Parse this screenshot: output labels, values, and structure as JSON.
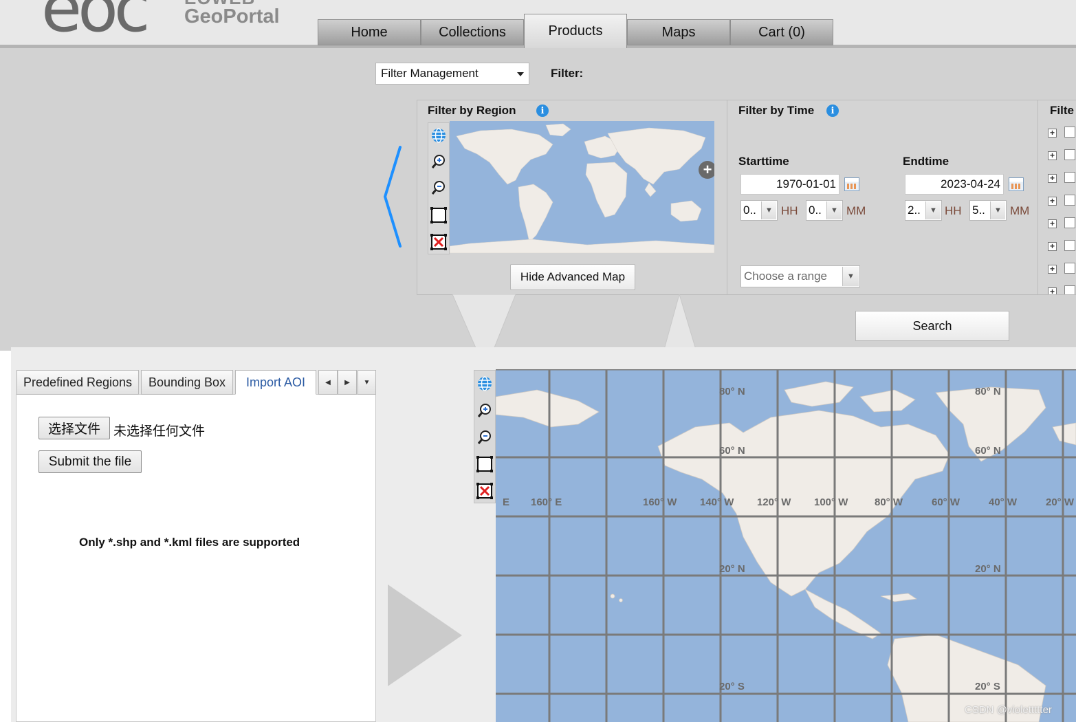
{
  "logo": {
    "mark": "eoc",
    "line1": "EOWEB",
    "line2": "GeoPortal"
  },
  "nav": {
    "tabs": [
      {
        "label": "Home"
      },
      {
        "label": "Collections"
      },
      {
        "label": "Products",
        "active": true
      },
      {
        "label": "Maps"
      },
      {
        "label": "Cart (0)"
      }
    ]
  },
  "filter_bar": {
    "management_select": "Filter Management",
    "filter_label": "Filter:"
  },
  "region_panel": {
    "title": "Filter by Region",
    "hide_map_button": "Hide Advanced Map",
    "tools": [
      "globe-icon",
      "zoom-in-icon",
      "zoom-out-icon",
      "draw-box-icon",
      "clear-box-icon"
    ]
  },
  "time_panel": {
    "title": "Filter by Time",
    "start": {
      "label": "Starttime",
      "date": "1970-01-01",
      "hour": "0..",
      "minute": "0..",
      "hour_unit": "HH",
      "minute_unit": "MM"
    },
    "end": {
      "label": "Endtime",
      "date": "2023-04-24",
      "hour": "2..",
      "minute": "5..",
      "hour_unit": "HH",
      "minute_unit": "MM"
    },
    "range_placeholder": "Choose a range"
  },
  "other_panel": {
    "title": "Filte"
  },
  "search_button": "Search",
  "aoi_panel": {
    "tabs": [
      {
        "label": "Predefined Regions"
      },
      {
        "label": "Bounding Box"
      },
      {
        "label": "Import AOI",
        "active": true
      }
    ],
    "choose_file_button": "选择文件",
    "no_file_text": "未选择任何文件",
    "submit_button": "Submit the file",
    "supported_note": "Only *.shp and *.kml files are supported"
  },
  "big_map": {
    "lat_labels": [
      "80° N",
      "60° N",
      "20° N",
      "20° S",
      "80° N",
      "60° N",
      "20° N",
      "20° S"
    ],
    "lon_labels": [
      "E",
      "160° E",
      "160° W",
      "140° W",
      "120° W",
      "100° W",
      "80° W",
      "60° W",
      "40° W",
      "20° W"
    ]
  },
  "watermark": "CSDN @violettttter",
  "colors": {
    "ocean": "#94b4db",
    "land": "#f0ece7",
    "grid": "#7a7a7a",
    "info": "#2a8ee0",
    "accent_chevron": "#1e90ff"
  }
}
